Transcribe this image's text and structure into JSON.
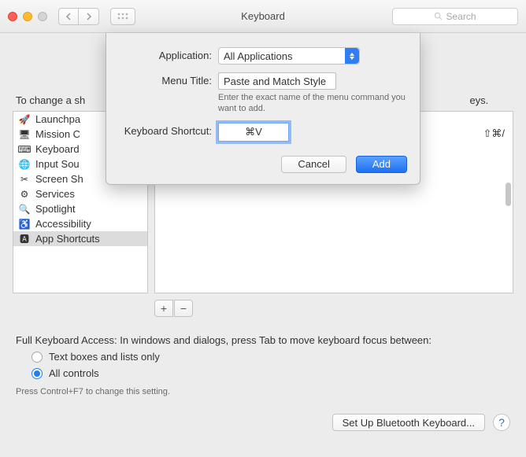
{
  "window": {
    "title": "Keyboard",
    "search_placeholder": "Search"
  },
  "intro": "To change a shortcut, select it, double-click the key combination, then type the new keys.",
  "intro_truncated_left": "To change a sh",
  "intro_truncated_right": "eys.",
  "sidebar": {
    "items": [
      {
        "label": "Launchpad & Dock",
        "trunc": "Launchpa"
      },
      {
        "label": "Mission Control",
        "trunc": "Mission C"
      },
      {
        "label": "Keyboard",
        "trunc": "Keyboard"
      },
      {
        "label": "Input Sources",
        "trunc": "Input Sou"
      },
      {
        "label": "Screen Shots",
        "trunc": "Screen Sh"
      },
      {
        "label": "Services",
        "trunc": "Services"
      },
      {
        "label": "Spotlight",
        "trunc": "Spotlight"
      },
      {
        "label": "Accessibility",
        "trunc": "Accessibility"
      },
      {
        "label": "App Shortcuts",
        "trunc": "App Shortcuts",
        "selected": true
      }
    ]
  },
  "right_shortcut": "⇧⌘/",
  "buttons": {
    "plus": "+",
    "minus": "−"
  },
  "fka": {
    "text": "Full Keyboard Access: In windows and dialogs, press Tab to move keyboard focus between:",
    "opt1": "Text boxes and lists only",
    "opt2": "All controls",
    "hint": "Press Control+F7 to change this setting."
  },
  "footer": {
    "bluetooth": "Set Up Bluetooth Keyboard...",
    "help": "?"
  },
  "sheet": {
    "app_label": "Application:",
    "app_value": "All Applications",
    "menu_label": "Menu Title:",
    "menu_value": "Paste and Match Style",
    "menu_desc": "Enter the exact name of the menu command you want to add.",
    "shortcut_label": "Keyboard Shortcut:",
    "shortcut_value": "⌘V",
    "cancel": "Cancel",
    "add": "Add"
  }
}
